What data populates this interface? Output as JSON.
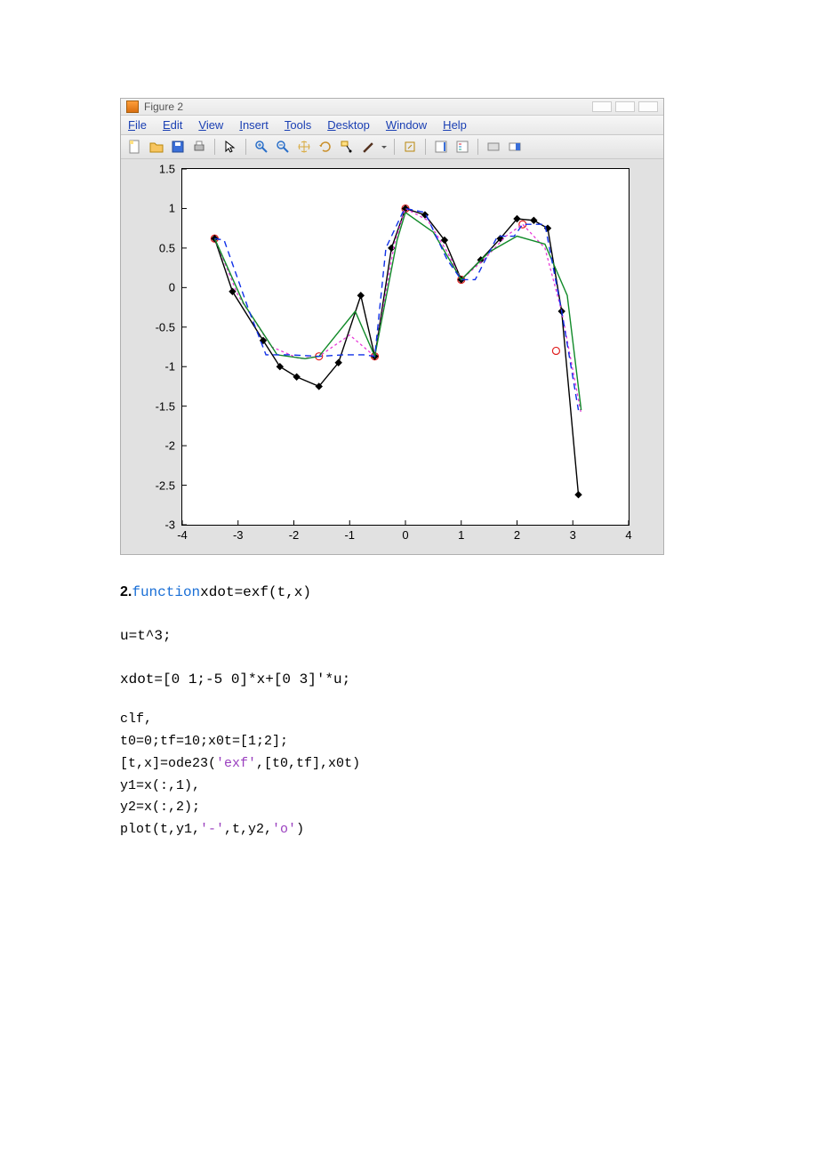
{
  "figure": {
    "title": "Figure 2",
    "menus": [
      "File",
      "Edit",
      "View",
      "Insert",
      "Tools",
      "Desktop",
      "Window",
      "Help"
    ],
    "toolbar_icons": [
      "new-file-icon",
      "open-folder-icon",
      "save-icon",
      "print-icon",
      "sep",
      "pointer-icon",
      "sep",
      "zoom-in-icon",
      "zoom-out-icon",
      "pan-icon",
      "rotate-icon",
      "data-cursor-icon",
      "brush-icon",
      "dropdown-icon",
      "sep",
      "link-icon",
      "sep",
      "colorbar-icon",
      "legend-icon",
      "sep",
      "hide-plot-icon",
      "show-plot-icon"
    ]
  },
  "chart_data": {
    "type": "line",
    "xlim": [
      -4,
      4
    ],
    "ylim": [
      -3,
      1.5
    ],
    "xticks": [
      -4,
      -3,
      -2,
      -1,
      0,
      1,
      2,
      3,
      4
    ],
    "yticks": [
      -3,
      -2.5,
      -2,
      -1.5,
      -1,
      -0.5,
      0,
      0.5,
      1,
      1.5
    ],
    "series": [
      {
        "name": "interp-nodes",
        "style": "red-circles",
        "x": [
          -3.42,
          -1.55,
          -0.55,
          0.0,
          1.0,
          2.1,
          2.7
        ],
        "y": [
          0.62,
          -0.87,
          -0.87,
          1.0,
          0.1,
          0.8,
          -0.8
        ]
      },
      {
        "name": "black-diamond-line",
        "style": "black-solid-diamond",
        "x": [
          -3.42,
          -3.1,
          -2.55,
          -2.25,
          -1.95,
          -1.55,
          -1.2,
          -0.8,
          -0.55,
          -0.25,
          0.0,
          0.35,
          0.7,
          1.0,
          1.35,
          1.7,
          2.0,
          2.3,
          2.55,
          2.8,
          3.1
        ],
        "y": [
          0.62,
          -0.05,
          -0.67,
          -1.0,
          -1.13,
          -1.25,
          -0.95,
          -0.1,
          -0.87,
          0.5,
          1.0,
          0.92,
          0.6,
          0.1,
          0.35,
          0.62,
          0.87,
          0.85,
          0.75,
          -0.3,
          -2.62
        ]
      },
      {
        "name": "magenta-dashed",
        "style": "magenta-dash",
        "x": [
          -3.42,
          -3.0,
          -2.4,
          -1.9,
          -1.55,
          -1.0,
          -0.55,
          -0.2,
          0.0,
          0.4,
          0.75,
          1.0,
          1.4,
          1.8,
          2.1,
          2.5,
          2.8,
          3.15
        ],
        "y": [
          0.62,
          -0.1,
          -0.75,
          -0.9,
          -0.87,
          -0.6,
          -0.87,
          0.55,
          1.0,
          0.85,
          0.45,
          0.1,
          0.35,
          0.65,
          0.8,
          0.5,
          -0.3,
          -1.6
        ]
      },
      {
        "name": "green-solid",
        "style": "green-solid",
        "x": [
          -3.42,
          -2.9,
          -2.3,
          -1.8,
          -1.55,
          -0.9,
          -0.55,
          -0.15,
          0.0,
          0.5,
          1.0,
          1.5,
          2.0,
          2.5,
          2.9,
          3.15
        ],
        "y": [
          0.62,
          -0.2,
          -0.85,
          -0.9,
          -0.87,
          -0.3,
          -0.87,
          0.6,
          0.95,
          0.7,
          0.1,
          0.45,
          0.65,
          0.55,
          -0.1,
          -1.55
        ]
      },
      {
        "name": "blue-dashed",
        "style": "blue-dash",
        "x": [
          -3.42,
          -3.25,
          -2.8,
          -2.5,
          -2.1,
          -1.55,
          -1.1,
          -0.75,
          -0.55,
          -0.35,
          -0.05,
          0.0,
          0.35,
          0.75,
          1.0,
          1.25,
          1.65,
          1.95,
          2.1,
          2.5,
          2.8,
          3.1
        ],
        "y": [
          0.62,
          0.6,
          -0.3,
          -0.85,
          -0.85,
          -0.87,
          -0.85,
          -0.85,
          -0.87,
          0.5,
          0.95,
          1.0,
          0.95,
          0.35,
          0.1,
          0.1,
          0.65,
          0.65,
          0.8,
          0.8,
          -0.3,
          -1.55
        ]
      }
    ]
  },
  "code": {
    "item_label": "2.",
    "fn_kw": "function",
    "fn_sig": "xdot=exf(t,x)",
    "line_u": "u=t^3;",
    "line_xdot": "xdot=[0 1;-5 0]*x+[0 3]'*u;",
    "c1": "clf,",
    "c2": "t0=0;tf=10;x0t=[1;2];",
    "c3a": "[t,x]=ode23(",
    "c3b": "'exf'",
    "c3c": ",[t0,tf],x0t)",
    "c4": "y1=x(:,1),",
    "c5": "y2=x(:,2);",
    "c6a": "plot(t,y1,",
    "c6b": "'-'",
    "c6c": ",t,y2,",
    "c6d": "'o'",
    "c6e": ")"
  }
}
